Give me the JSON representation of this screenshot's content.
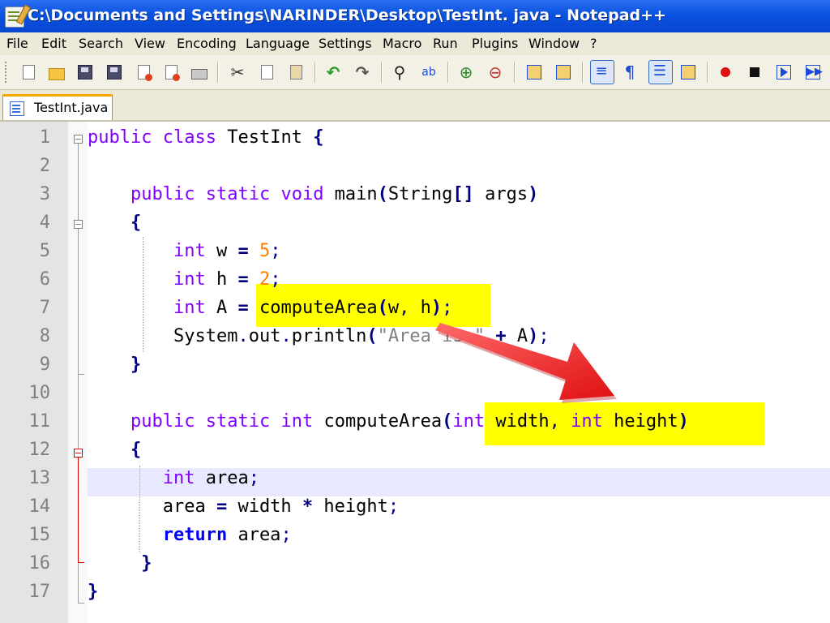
{
  "window": {
    "title": "C:\\Documents and Settings\\NARINDER\\Desktop\\TestInt. java - Notepad++"
  },
  "menu": [
    "File",
    "Edit",
    "Search",
    "View",
    "Encoding",
    "Language",
    "Settings",
    "Macro",
    "Run",
    "Plugins",
    "Window",
    "?"
  ],
  "toolbar": {
    "icons": [
      "new-file-icon",
      "open-file-icon",
      "save-icon",
      "save-all-icon",
      "close-icon",
      "close-all-icon",
      "print-icon",
      "cut-icon",
      "copy-icon",
      "paste-icon",
      "undo-icon",
      "redo-icon",
      "find-icon",
      "replace-icon",
      "zoom-in-icon",
      "zoom-out-icon",
      "sync-vertical-icon",
      "sync-horizontal-icon",
      "word-wrap-icon",
      "show-all-characters-icon",
      "indent-guide-icon",
      "user-defined-language-icon",
      "record-macro-icon",
      "stop-recording-icon",
      "play-macro-icon",
      "run-macro-multiple-icon"
    ],
    "pilcrow": "¶"
  },
  "tab": {
    "label": "TestInt.java"
  },
  "editor": {
    "line_numbers": [
      "1",
      "2",
      "3",
      "4",
      "5",
      "6",
      "7",
      "8",
      "9",
      "10",
      "11",
      "12",
      "13",
      "14",
      "15",
      "16",
      "17"
    ],
    "current_line": 13,
    "lines": [
      [
        "",
        "public",
        " ",
        "class",
        " TestInt ",
        "{"
      ],
      [
        ""
      ],
      [
        "    ",
        "public",
        " ",
        "static",
        " ",
        "void",
        " main",
        "(",
        "String",
        "[]",
        " args",
        ")"
      ],
      [
        "    ",
        "{"
      ],
      [
        "        ",
        "int",
        " w ",
        "=",
        " ",
        "5",
        ";"
      ],
      [
        "        ",
        "int",
        " h ",
        "=",
        " ",
        "2",
        ";"
      ],
      [
        "        ",
        "int",
        " A ",
        "=",
        " computeArea",
        "(",
        "w",
        ",",
        " h",
        ")",
        ";"
      ],
      [
        "        ",
        "System",
        ".",
        "out",
        ".",
        "println",
        "(",
        "\"Area is \"",
        " ",
        "+",
        " A",
        ")",
        ";"
      ],
      [
        "    ",
        "}"
      ],
      [
        ""
      ],
      [
        "    ",
        "public",
        " ",
        "static",
        " ",
        "int",
        " computeArea",
        "(",
        "int",
        " width",
        ",",
        " ",
        "int",
        " height",
        ")"
      ],
      [
        "    ",
        "{"
      ],
      [
        "       ",
        "int",
        " area",
        ";"
      ],
      [
        "       ",
        "area ",
        "=",
        " width ",
        "*",
        " height",
        ";"
      ],
      [
        "       ",
        "return",
        " area",
        ";"
      ],
      [
        "     ",
        "}"
      ],
      [
        "",
        "}"
      ]
    ]
  },
  "colors": {
    "titlebar": "#0a52e0",
    "keyword": "#8000ff",
    "keyword_bold": "#0000ff",
    "number": "#ff8000",
    "operator": "#000080",
    "string": "#808080",
    "highlight": "#ffff00",
    "arrow": "#ff2a2a",
    "current_line": "#e8e8ff"
  }
}
